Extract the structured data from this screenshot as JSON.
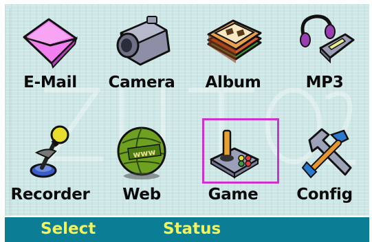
{
  "menu": {
    "items": [
      {
        "label": "E-Mail",
        "icon": "envelope-icon"
      },
      {
        "label": "Camera",
        "icon": "camera-icon"
      },
      {
        "label": "Album",
        "icon": "photo-album-icon"
      },
      {
        "label": "MP3",
        "icon": "mp3-player-icon"
      },
      {
        "label": "Recorder",
        "icon": "microphone-icon"
      },
      {
        "label": "Web",
        "icon": "globe-icon"
      },
      {
        "label": "Game",
        "icon": "joystick-icon"
      },
      {
        "label": "Config",
        "icon": "tools-icon"
      }
    ],
    "selected": "Game"
  },
  "softkeys": {
    "left": "Select",
    "right": "Status"
  },
  "colors": {
    "background": "#cde7e6",
    "softkey_bar": "#0b7d94",
    "softkey_text": "#f3f35a",
    "selection_frame": "#cc33cc"
  }
}
